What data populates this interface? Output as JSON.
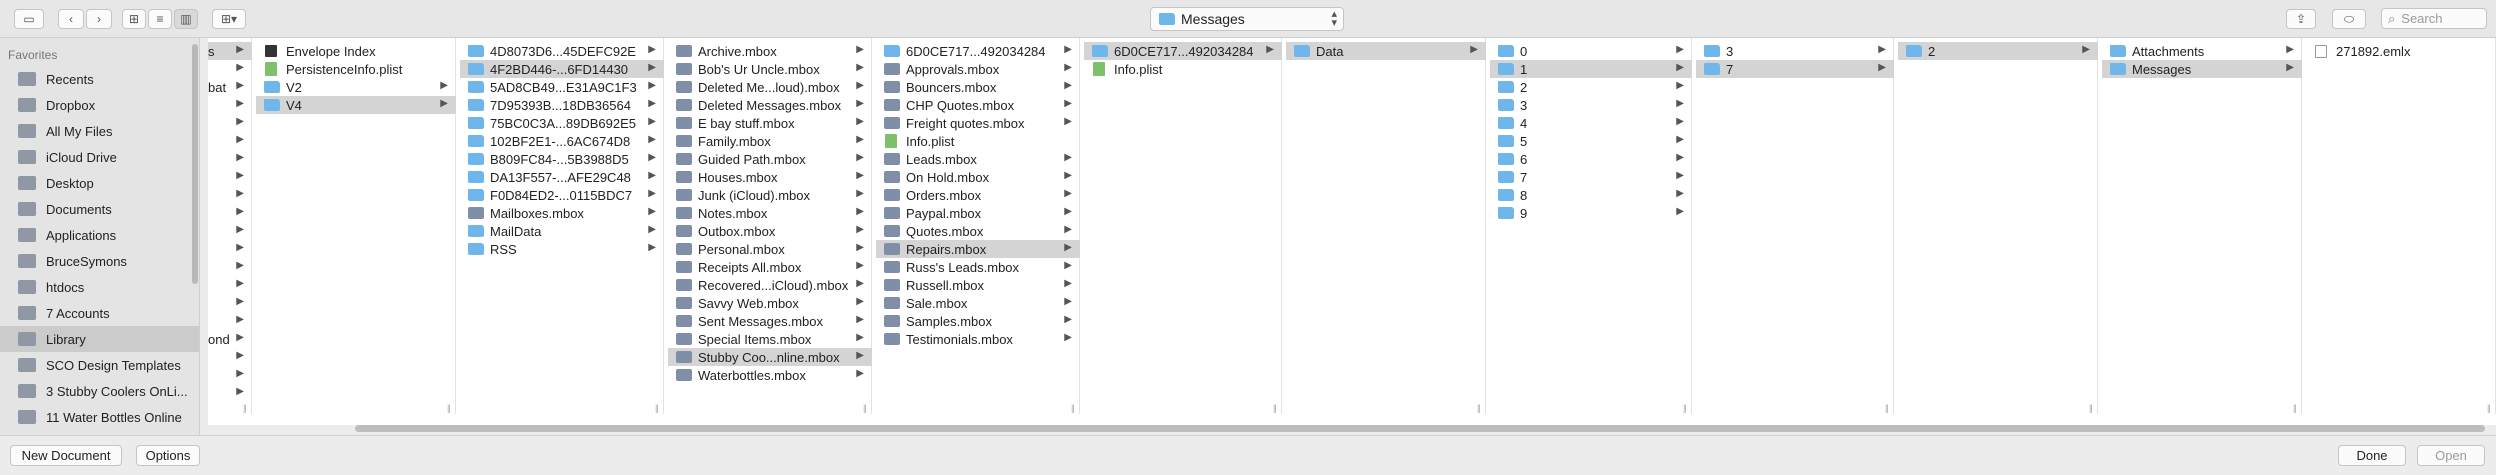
{
  "toolbar": {
    "path_label": "Messages",
    "search_placeholder": "Search"
  },
  "sidebar": {
    "heading": "Favorites",
    "items": [
      {
        "label": "Recents",
        "icon": "clock-icon"
      },
      {
        "label": "Dropbox",
        "icon": "dropbox-icon"
      },
      {
        "label": "All My Files",
        "icon": "all-files-icon"
      },
      {
        "label": "iCloud Drive",
        "icon": "cloud-icon"
      },
      {
        "label": "Desktop",
        "icon": "desktop-icon"
      },
      {
        "label": "Documents",
        "icon": "documents-icon"
      },
      {
        "label": "Applications",
        "icon": "applications-icon"
      },
      {
        "label": "BruceSymons",
        "icon": "home-icon"
      },
      {
        "label": "htdocs",
        "icon": "folder-icon"
      },
      {
        "label": "7 Accounts",
        "icon": "folder-icon"
      },
      {
        "label": "Library",
        "icon": "folder-icon",
        "selected": true
      },
      {
        "label": "SCO Design Templates",
        "icon": "folder-icon"
      },
      {
        "label": "3 Stubby Coolers OnLi...",
        "icon": "folder-icon"
      },
      {
        "label": "11 Water Bottles Online",
        "icon": "folder-icon"
      }
    ]
  },
  "columns": [
    {
      "rows": [
        {
          "label": "s",
          "type": "none",
          "chev": true,
          "sel": true
        },
        {
          "label": "",
          "type": "none",
          "chev": true
        },
        {
          "label": "bat",
          "type": "none",
          "chev": true
        },
        {
          "label": "",
          "type": "none",
          "chev": true
        },
        {
          "label": "",
          "type": "none",
          "chev": true
        },
        {
          "label": "",
          "type": "none",
          "chev": true
        },
        {
          "label": "",
          "type": "none",
          "chev": true
        },
        {
          "label": "",
          "type": "none",
          "chev": true
        },
        {
          "label": "",
          "type": "none",
          "chev": true
        },
        {
          "label": "",
          "type": "none",
          "chev": true
        },
        {
          "label": "",
          "type": "none",
          "chev": true
        },
        {
          "label": "",
          "type": "none",
          "chev": true
        },
        {
          "label": "",
          "type": "none",
          "chev": true
        },
        {
          "label": "",
          "type": "none",
          "chev": true
        },
        {
          "label": "",
          "type": "none",
          "chev": true
        },
        {
          "label": "",
          "type": "none",
          "chev": true
        },
        {
          "label": "ond",
          "type": "none",
          "chev": true
        },
        {
          "label": "",
          "type": "none",
          "chev": true
        },
        {
          "label": "",
          "type": "none",
          "chev": true
        },
        {
          "label": "",
          "type": "none",
          "chev": true
        }
      ]
    },
    {
      "rows": [
        {
          "label": "Envelope Index",
          "type": "index"
        },
        {
          "label": "PersistenceInfo.plist",
          "type": "plist"
        },
        {
          "label": "V2",
          "type": "folder",
          "chev": true
        },
        {
          "label": "V4",
          "type": "folder",
          "chev": true,
          "sel": true
        }
      ]
    },
    {
      "rows": [
        {
          "label": "4D8073D6...45DEFC92E",
          "type": "folder",
          "chev": true
        },
        {
          "label": "4F2BD446-...6FD14430",
          "type": "folder",
          "chev": true,
          "sel": true
        },
        {
          "label": "5AD8CB49...E31A9C1F3",
          "type": "folder",
          "chev": true
        },
        {
          "label": "7D95393B...18DB36564",
          "type": "folder",
          "chev": true
        },
        {
          "label": "75BC0C3A...89DB692E5",
          "type": "folder",
          "chev": true
        },
        {
          "label": "102BF2E1-...6AC674D8",
          "type": "folder",
          "chev": true
        },
        {
          "label": "B809FC84-...5B3988D5",
          "type": "folder",
          "chev": true
        },
        {
          "label": "DA13F557-...AFE29C48",
          "type": "folder",
          "chev": true
        },
        {
          "label": "F0D84ED2-...0115BDC7",
          "type": "folder",
          "chev": true
        },
        {
          "label": "Mailboxes.mbox",
          "type": "mbox",
          "chev": true
        },
        {
          "label": "MailData",
          "type": "folder",
          "chev": true
        },
        {
          "label": "RSS",
          "type": "folder",
          "chev": true
        }
      ]
    },
    {
      "rows": [
        {
          "label": "Archive.mbox",
          "type": "mbox",
          "chev": true
        },
        {
          "label": "Bob's Ur Uncle.mbox",
          "type": "mbox",
          "chev": true
        },
        {
          "label": "Deleted Me...loud).mbox",
          "type": "mbox",
          "chev": true
        },
        {
          "label": "Deleted Messages.mbox",
          "type": "mbox",
          "chev": true
        },
        {
          "label": "E bay stuff.mbox",
          "type": "mbox",
          "chev": true
        },
        {
          "label": "Family.mbox",
          "type": "mbox",
          "chev": true
        },
        {
          "label": "Guided Path.mbox",
          "type": "mbox",
          "chev": true
        },
        {
          "label": "Houses.mbox",
          "type": "mbox",
          "chev": true
        },
        {
          "label": "Junk (iCloud).mbox",
          "type": "mbox",
          "chev": true
        },
        {
          "label": "Notes.mbox",
          "type": "mbox",
          "chev": true
        },
        {
          "label": "Outbox.mbox",
          "type": "mbox",
          "chev": true
        },
        {
          "label": "Personal.mbox",
          "type": "mbox",
          "chev": true
        },
        {
          "label": "Receipts All.mbox",
          "type": "mbox",
          "chev": true
        },
        {
          "label": "Recovered...iCloud).mbox",
          "type": "mbox",
          "chev": true
        },
        {
          "label": "Savvy Web.mbox",
          "type": "mbox",
          "chev": true
        },
        {
          "label": "Sent Messages.mbox",
          "type": "mbox",
          "chev": true
        },
        {
          "label": "Special Items.mbox",
          "type": "mbox",
          "chev": true
        },
        {
          "label": "Stubby Coo...nline.mbox",
          "type": "mbox",
          "chev": true,
          "sel": true
        },
        {
          "label": "Waterbottles.mbox",
          "type": "mbox",
          "chev": true
        }
      ]
    },
    {
      "rows": [
        {
          "label": "6D0CE717...492034284",
          "type": "folder",
          "chev": true
        },
        {
          "label": "Approvals.mbox",
          "type": "mbox",
          "chev": true
        },
        {
          "label": "Bouncers.mbox",
          "type": "mbox",
          "chev": true
        },
        {
          "label": "CHP Quotes.mbox",
          "type": "mbox",
          "chev": true
        },
        {
          "label": "Freight quotes.mbox",
          "type": "mbox",
          "chev": true
        },
        {
          "label": "Info.plist",
          "type": "plist"
        },
        {
          "label": "Leads.mbox",
          "type": "mbox",
          "chev": true
        },
        {
          "label": "On Hold.mbox",
          "type": "mbox",
          "chev": true
        },
        {
          "label": "Orders.mbox",
          "type": "mbox",
          "chev": true
        },
        {
          "label": "Paypal.mbox",
          "type": "mbox",
          "chev": true
        },
        {
          "label": "Quotes.mbox",
          "type": "mbox",
          "chev": true
        },
        {
          "label": "Repairs.mbox",
          "type": "mbox",
          "chev": true,
          "sel": true
        },
        {
          "label": "Russ's Leads.mbox",
          "type": "mbox",
          "chev": true
        },
        {
          "label": "Russell.mbox",
          "type": "mbox",
          "chev": true
        },
        {
          "label": "Sale.mbox",
          "type": "mbox",
          "chev": true
        },
        {
          "label": "Samples.mbox",
          "type": "mbox",
          "chev": true
        },
        {
          "label": "Testimonials.mbox",
          "type": "mbox",
          "chev": true
        }
      ]
    },
    {
      "rows": [
        {
          "label": "6D0CE717...492034284",
          "type": "folder",
          "chev": true,
          "sel": true
        },
        {
          "label": "Info.plist",
          "type": "plist"
        }
      ]
    },
    {
      "rows": [
        {
          "label": "Data",
          "type": "folder",
          "chev": true,
          "sel": true
        }
      ]
    },
    {
      "rows": [
        {
          "label": "0",
          "type": "folder",
          "chev": true
        },
        {
          "label": "1",
          "type": "folder",
          "chev": true,
          "sel": true
        },
        {
          "label": "2",
          "type": "folder",
          "chev": true
        },
        {
          "label": "3",
          "type": "folder",
          "chev": true
        },
        {
          "label": "4",
          "type": "folder",
          "chev": true
        },
        {
          "label": "5",
          "type": "folder",
          "chev": true
        },
        {
          "label": "6",
          "type": "folder",
          "chev": true
        },
        {
          "label": "7",
          "type": "folder",
          "chev": true
        },
        {
          "label": "8",
          "type": "folder",
          "chev": true
        },
        {
          "label": "9",
          "type": "folder",
          "chev": true
        }
      ]
    },
    {
      "rows": [
        {
          "label": "3",
          "type": "folder",
          "chev": true
        },
        {
          "label": "7",
          "type": "folder",
          "chev": true,
          "sel": true
        }
      ]
    },
    {
      "rows": [
        {
          "label": "2",
          "type": "folder",
          "chev": true,
          "sel": true
        }
      ]
    },
    {
      "rows": [
        {
          "label": "Attachments",
          "type": "folder",
          "chev": true
        },
        {
          "label": "Messages",
          "type": "folder",
          "chev": true,
          "sel": true
        }
      ]
    },
    {
      "rows": [
        {
          "label": "271892.emlx",
          "type": "emlx"
        }
      ]
    }
  ],
  "bottom": {
    "new_document": "New Document",
    "options": "Options",
    "done": "Done",
    "open": "Open"
  }
}
